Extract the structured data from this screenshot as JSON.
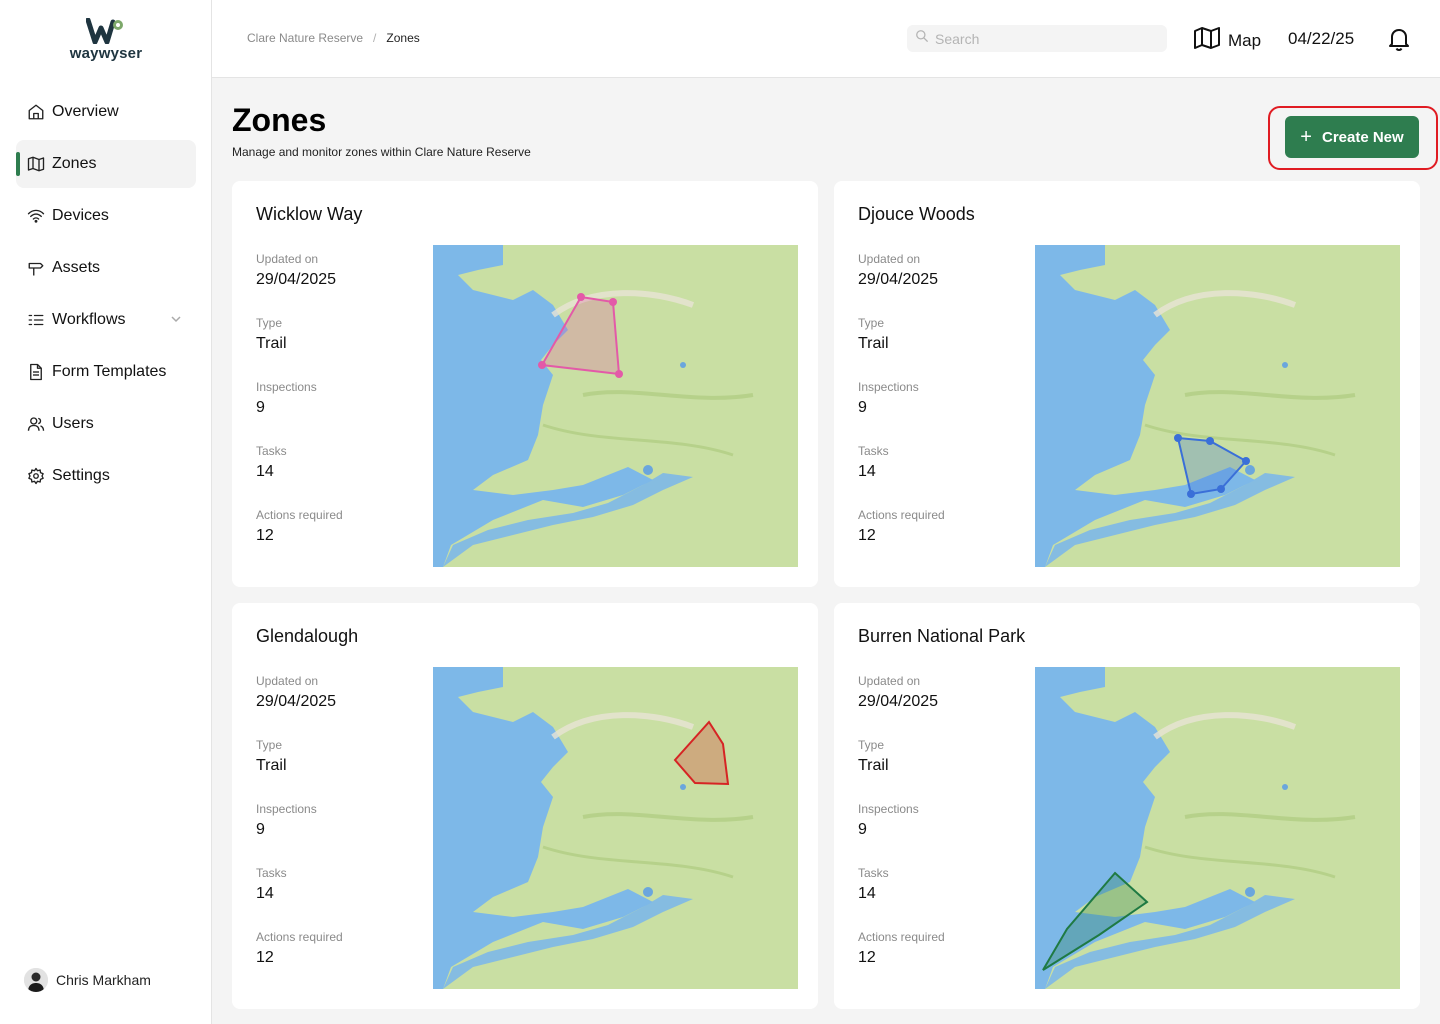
{
  "app": {
    "logo_text": "waywyser"
  },
  "sidebar": {
    "items": [
      {
        "label": "Overview",
        "icon": "home-icon"
      },
      {
        "label": "Zones",
        "icon": "map-icon",
        "active": true
      },
      {
        "label": "Devices",
        "icon": "wifi-icon"
      },
      {
        "label": "Assets",
        "icon": "signpost-icon"
      },
      {
        "label": "Workflows",
        "icon": "list-icon",
        "has_submenu": true
      },
      {
        "label": "Form Templates",
        "icon": "document-icon"
      },
      {
        "label": "Users",
        "icon": "users-icon"
      },
      {
        "label": "Settings",
        "icon": "gear-icon"
      }
    ],
    "user": {
      "name": "Chris Markham"
    }
  },
  "header": {
    "breadcrumb": [
      "Clare Nature Reserve",
      "Zones"
    ],
    "search_placeholder": "Search",
    "map_label": "Map",
    "date": "04/22/25"
  },
  "page": {
    "title": "Zones",
    "subtitle": "Manage and monitor zones within Clare Nature Reserve",
    "create_label": "Create New"
  },
  "labels": {
    "updated": "Updated on",
    "type": "Type",
    "inspections": "Inspections",
    "tasks": "Tasks",
    "actions": "Actions required"
  },
  "zones": [
    {
      "name": "Wicklow Way",
      "updated": "29/04/2025",
      "type": "Trail",
      "inspections": "9",
      "tasks": "14",
      "actions": "12",
      "color": "#e35aa8"
    },
    {
      "name": "Djouce Woods",
      "updated": "29/04/2025",
      "type": "Trail",
      "inspections": "9",
      "tasks": "14",
      "actions": "12",
      "color": "#3a6fd8"
    },
    {
      "name": "Glendalough",
      "updated": "29/04/2025",
      "type": "Trail",
      "inspections": "9",
      "tasks": "14",
      "actions": "12",
      "color": "#d62424"
    },
    {
      "name": "Burren National Park",
      "updated": "29/04/2025",
      "type": "Trail",
      "inspections": "9",
      "tasks": "14",
      "actions": "12",
      "color": "#1f7a43"
    }
  ],
  "colors": {
    "accent": "#2e7d4f",
    "highlight": "#e01b22",
    "water": "#7db8e8",
    "land": "#c9dfa3"
  }
}
